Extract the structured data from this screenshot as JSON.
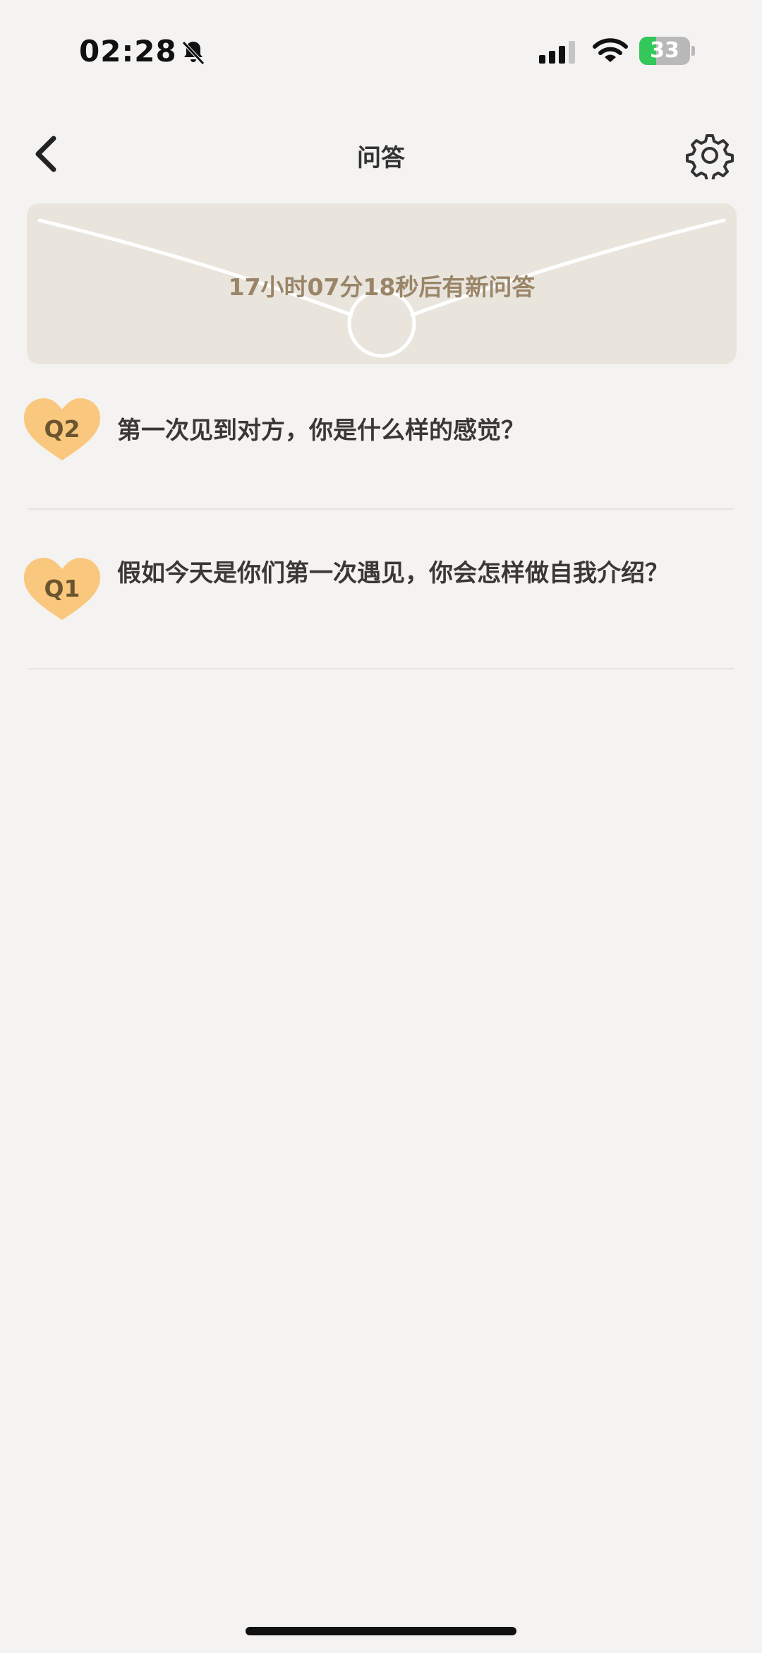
{
  "status_bar": {
    "time": "02:28",
    "battery_level": "33",
    "battery_fraction": 0.33,
    "icons": [
      "bell-slash-icon",
      "signal-icon",
      "wifi-icon",
      "battery-icon"
    ]
  },
  "nav": {
    "title": "问答",
    "back_icon": "chevron-left-icon",
    "settings_icon": "gear-icon"
  },
  "banner": {
    "countdown_text": "17小时07分18秒后有新问答"
  },
  "questions": [
    {
      "badge": "Q2",
      "text": "第一次见到对方，你是什么样的感觉？"
    },
    {
      "badge": "Q1",
      "text": "假如今天是你们第一次遇见，你会怎样做自我介绍？"
    }
  ],
  "colors": {
    "background": "#f4f3f1",
    "banner_bg": "#e9e5dd",
    "banner_text": "#9a8568",
    "badge": "#f9c77d",
    "battery_green": "#34c759"
  }
}
